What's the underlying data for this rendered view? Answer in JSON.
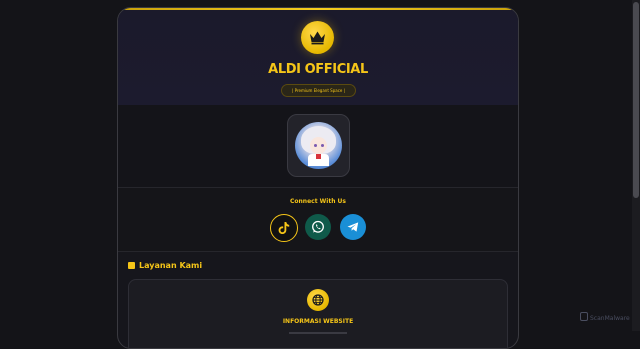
{
  "header": {
    "brand_title": "ALDI OFFICIAL",
    "tagline": "| Premium Elegant Space |"
  },
  "connect": {
    "title": "Connect With Us",
    "links": [
      {
        "name": "tiktok",
        "icon": "tiktok-icon"
      },
      {
        "name": "whatsapp",
        "icon": "whatsapp-icon"
      },
      {
        "name": "telegram",
        "icon": "telegram-icon"
      }
    ]
  },
  "services": {
    "heading": "Layanan Kami",
    "card": {
      "title": "INFORMASI WEBSITE",
      "icon": "globe-icon"
    }
  },
  "watermark": {
    "text": "ScanMalware"
  },
  "colors": {
    "accent": "#f5c518",
    "background": "#141418",
    "whatsapp": "#0f5a4a",
    "telegram": "#1a8fd6"
  }
}
